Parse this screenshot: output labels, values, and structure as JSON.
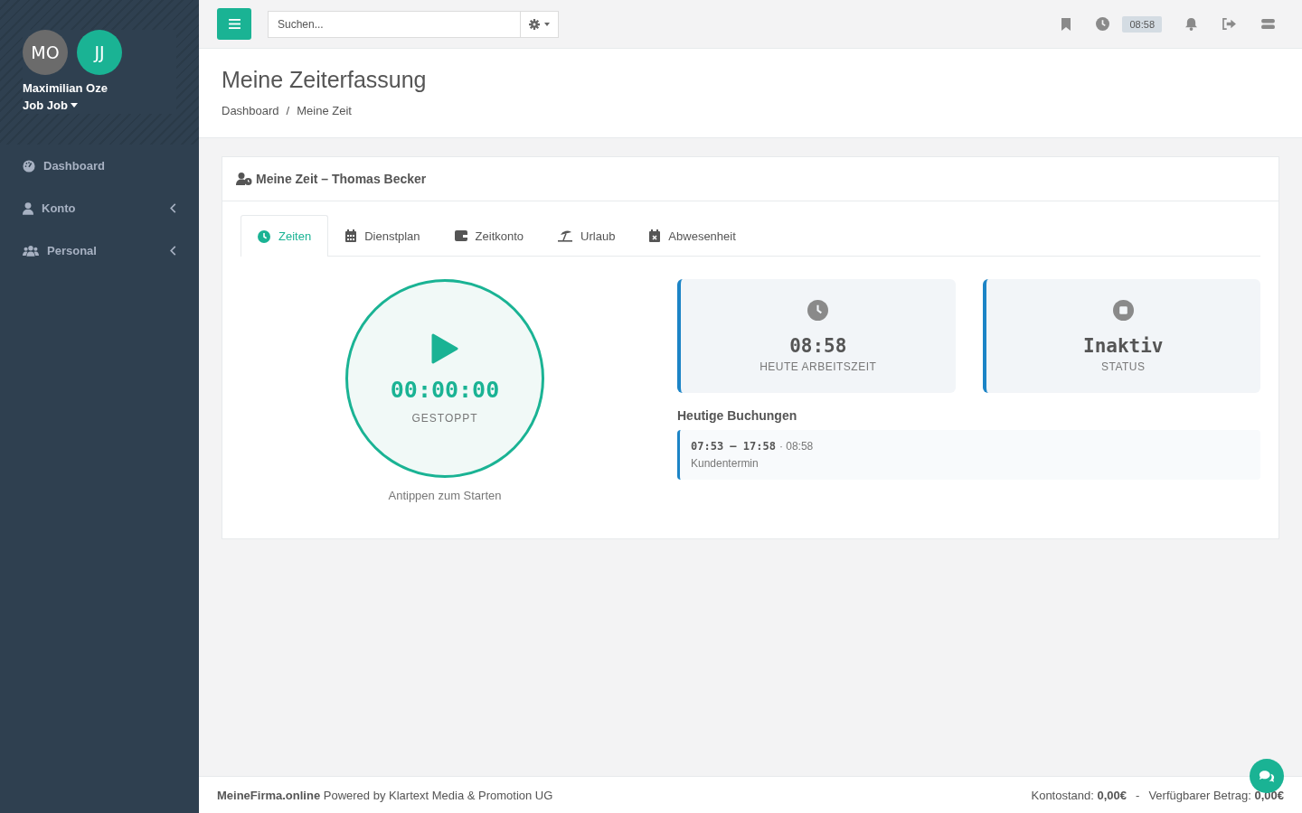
{
  "sidebar": {
    "avatars": [
      {
        "initials": "MO",
        "color": "#6b6b6b"
      },
      {
        "initials": "JJ",
        "color": "#1ab394"
      }
    ],
    "user_name": "Maximilian Oze",
    "role": "Job Job",
    "items": [
      {
        "label": "Dashboard",
        "kind": "gauge",
        "has_submenu": false
      },
      {
        "label": "Konto",
        "kind": "user",
        "has_submenu": true
      },
      {
        "label": "Personal",
        "kind": "users",
        "has_submenu": true
      }
    ]
  },
  "topbar": {
    "search": {
      "placeholder": "Suchen..."
    },
    "clock_badge": "08:58"
  },
  "page": {
    "title": "Meine Zeiterfassung",
    "breadcrumb": {
      "separator": "/",
      "items": [
        "Dashboard",
        "Meine Zeit"
      ]
    }
  },
  "card": {
    "title": "Meine Zeit – Thomas Becker",
    "tabs": [
      {
        "label": "Zeiten",
        "kind": "clock",
        "selected": true
      },
      {
        "label": "Dienstplan",
        "kind": "calendar",
        "selected": false
      },
      {
        "label": "Zeitkonto",
        "kind": "wallet",
        "selected": false
      },
      {
        "label": "Urlaub",
        "kind": "umbrella",
        "selected": false
      },
      {
        "label": "Abwesenheit",
        "kind": "absence",
        "selected": false
      }
    ],
    "timer": {
      "time": "00:00:00",
      "state": "GESTOPPT",
      "hint": "Antippen zum Starten"
    },
    "stats": [
      {
        "kind": "clock",
        "value": "08:58",
        "label": "HEUTE ARBEITSZEIT"
      },
      {
        "kind": "stop",
        "value": "Inaktiv",
        "label": "STATUS"
      }
    ],
    "bookings_title": "Heutige Buchungen",
    "bookings": [
      {
        "range": "07:53 – 17:58",
        "duration": "· 08:58",
        "note": "Kundentermin"
      }
    ]
  },
  "footer": {
    "brand": "MeineFirma.online",
    "text": "Powered by Klartext Media & Promotion UG",
    "balance": "Kontostand: **0,00€**",
    "separator": "-",
    "available": "Verfügbarer Betrag: **0,00€**"
  }
}
